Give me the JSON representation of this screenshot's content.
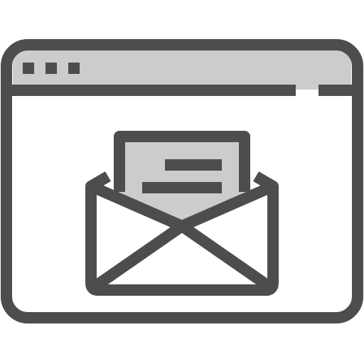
{
  "icon": {
    "name": "browser-window-email-icon",
    "parts": {
      "window": "browser-window-icon",
      "dots": [
        "window-dot-icon",
        "window-dot-icon",
        "window-dot-icon"
      ],
      "envelope": "open-envelope-icon",
      "letter": "letter-icon"
    }
  },
  "colors": {
    "stroke": "#4d4d4d",
    "titlebar_fill": "#cccccc",
    "letter_fill": "#cccccc",
    "background": "#ffffff"
  }
}
